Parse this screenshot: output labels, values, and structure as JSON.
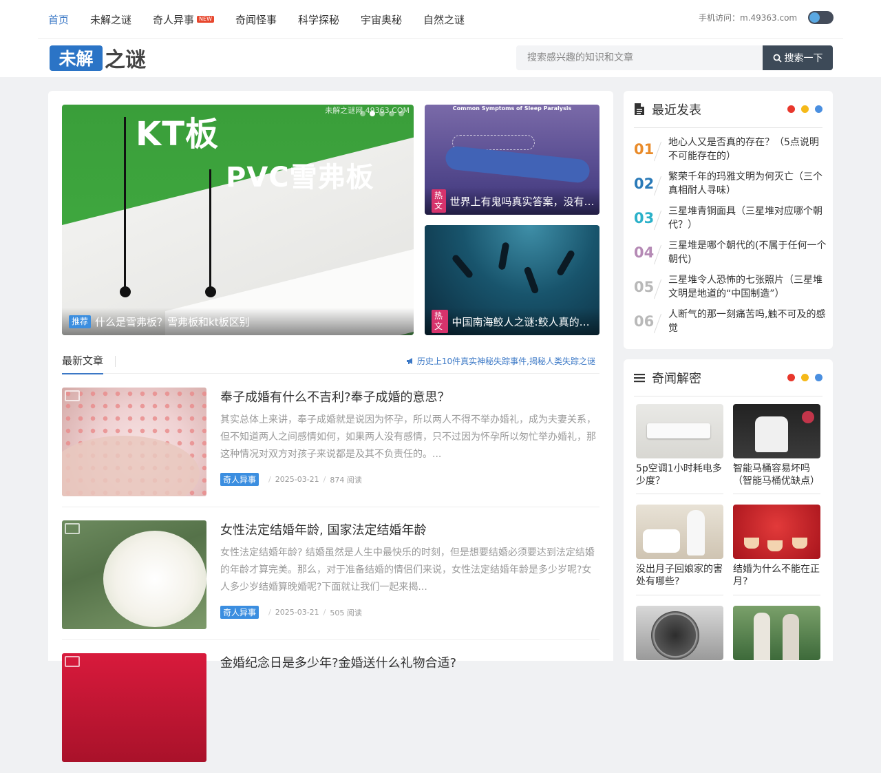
{
  "nav": {
    "items": [
      "首页",
      "未解之谜",
      "奇人异事",
      "奇闻怪事",
      "科学探秘",
      "宇宙奥秘",
      "自然之谜"
    ],
    "new_badge": "NEW",
    "mobile_text": "手机访问：m.49363.com"
  },
  "logo": {
    "box_text": "未解",
    "tail_text": "之谜"
  },
  "search": {
    "placeholder": "搜索感兴趣的知识和文章",
    "button_label": "搜索一下"
  },
  "slider": {
    "main": {
      "tag": "推荐",
      "title": "什么是雪弗板？雪弗板和kt板区别",
      "image_text_1": "KT板",
      "image_text_2": "PVC雪弗板",
      "watermark": "未解之谜网   49363.COM"
    },
    "side": [
      {
        "tag": "热文",
        "title": "世界上有鬼吗真实答案，没有鬼(鬼压床是身体的正常生理现象)",
        "image_text": "Common Symptoms of Sleep Paralysis"
      },
      {
        "tag": "热文",
        "title": "中国南海鲛人之谜:鲛人真的存在吗(中国人鱼传说)"
      }
    ]
  },
  "latest": {
    "tab_label": "最新文章",
    "notice": "历史上10件真实神秘失踪事件,揭秘人类失踪之谜"
  },
  "articles": [
    {
      "title": "奉子成婚有什么不吉利?奉子成婚的意思？",
      "excerpt": "其实总体上来讲，奉子成婚就是说因为怀孕，所以两人不得不举办婚礼，成为夫妻关系，但不知道两人之间感情如何，如果两人没有感情，只不过因为怀孕所以匆忙举办婚礼，那这种情况对双方对孩子来说都是及其不负责任的。...",
      "category": "奇人异事",
      "date": "2025-03-21",
      "reads": "874 阅读"
    },
    {
      "title": "女性法定结婚年龄, 国家法定结婚年龄",
      "excerpt": "女性法定结婚年龄? 结婚虽然是人生中最快乐的时刻，但是想要结婚必须要达到法定结婚的年龄才算完美。那么，对于准备结婚的情侣们来说，女性法定结婚年龄是多少岁呢?女人多少岁结婚算晚婚呢?下面就让我们一起来揭...",
      "category": "奇人异事",
      "date": "2025-03-21",
      "reads": "505 阅读"
    },
    {
      "title": "金婚纪念日是多少年?金婚送什么礼物合适?",
      "excerpt": "",
      "category": "",
      "date": "",
      "reads": ""
    }
  ],
  "recent": {
    "title": "最近发表",
    "items": [
      {
        "num": "01",
        "text": "地心人又是否真的存在？（5点说明不可能存在的）"
      },
      {
        "num": "02",
        "text": "繁荣千年的玛雅文明为何灭亡（三个真相耐人寻味）"
      },
      {
        "num": "03",
        "text": "三星堆青铜面具（三星堆对应哪个朝代？）"
      },
      {
        "num": "04",
        "text": "三星堆是哪个朝代的(不属于任何一个朝代)"
      },
      {
        "num": "05",
        "text": "三星堆令人恐怖的七张照片（三星堆文明是地道的“中国制造”）"
      },
      {
        "num": "06",
        "text": "人断气的那一刻痛苦吗,触不可及的感觉"
      }
    ],
    "num_colors": [
      "#e98b2a",
      "#2a7ab8",
      "#2bb1c9",
      "#b58ab5",
      "#b9b9b9",
      "#b9b9b9"
    ]
  },
  "mystery": {
    "title": "奇闻解密",
    "items": [
      {
        "text": "5p空调1小时耗电多少度？"
      },
      {
        "text": "智能马桶容易坏吗（智能马桶优缺点）"
      },
      {
        "text": "没出月子回娘家的害处有哪些?"
      },
      {
        "text": "结婚为什么不能在正月?"
      },
      {
        "text": ""
      },
      {
        "text": ""
      }
    ]
  },
  "colors": {
    "accent": "#3b78c6",
    "dot_red": "#e8372c",
    "dot_yellow": "#f5b919",
    "dot_blue": "#4a8fe0",
    "search_button": "#3d4a58"
  },
  "icons": [
    "search-icon",
    "document-icon",
    "menu-icon",
    "megaphone-icon",
    "image-icon"
  ]
}
